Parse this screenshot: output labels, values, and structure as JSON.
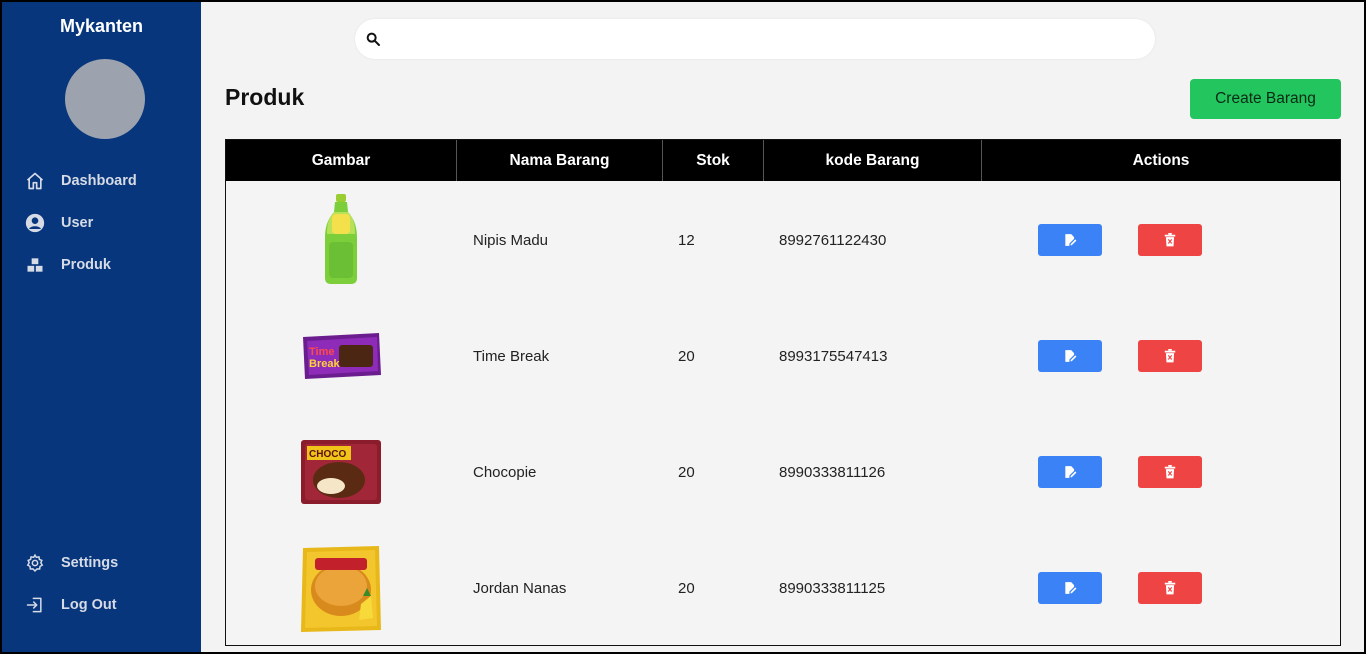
{
  "app": {
    "brand": "Mykanten"
  },
  "sidebar": {
    "items": [
      {
        "label": "Dashboard",
        "icon": "home-icon"
      },
      {
        "label": "User",
        "icon": "user-circle-icon"
      },
      {
        "label": "Produk",
        "icon": "boxes-icon"
      }
    ],
    "bottom_items": [
      {
        "label": "Settings",
        "icon": "gear-icon"
      },
      {
        "label": "Log Out",
        "icon": "logout-icon"
      }
    ]
  },
  "search": {
    "placeholder": "",
    "value": ""
  },
  "page": {
    "title": "Produk",
    "create_label": "Create Barang"
  },
  "table": {
    "headers": [
      "Gambar",
      "Nama Barang",
      "Stok",
      "kode Barang",
      "Actions"
    ],
    "rows": [
      {
        "image": "bottle-drink",
        "name": "Nipis Madu",
        "stock": "12",
        "code": "8992761122430"
      },
      {
        "image": "purple-wrapper-snack",
        "name": "Time Break",
        "stock": "20",
        "code": "8993175547413"
      },
      {
        "image": "choco-pie-pack",
        "name": "Chocopie",
        "stock": "20",
        "code": "8990333811126"
      },
      {
        "image": "bread-pack",
        "name": "Jordan Nanas",
        "stock": "20",
        "code": "8990333811125"
      }
    ]
  },
  "colors": {
    "sidebar": "#07367c",
    "create_button": "#22c55e",
    "edit_button": "#3b82f6",
    "delete_button": "#ef4444"
  }
}
